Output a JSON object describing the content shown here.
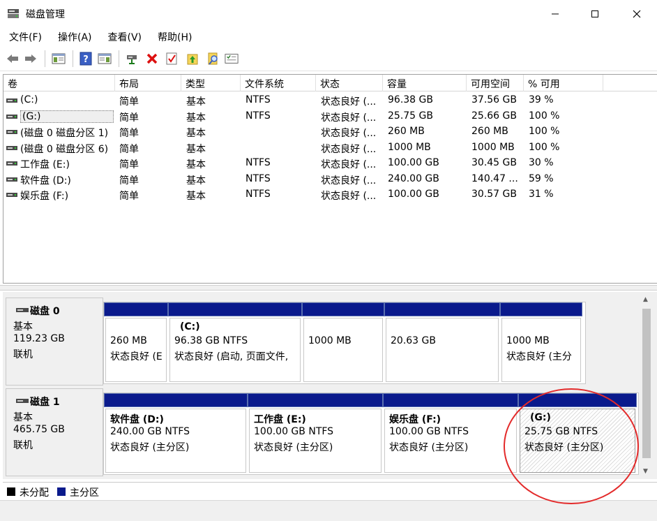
{
  "window": {
    "title": "磁盘管理",
    "controls": {
      "minimize": "minimize-icon",
      "maximize": "maximize-icon",
      "close": "close-icon"
    }
  },
  "menu": {
    "items": [
      {
        "label": "文件(F)"
      },
      {
        "label": "操作(A)"
      },
      {
        "label": "查看(V)"
      },
      {
        "label": "帮助(H)"
      }
    ]
  },
  "toolbar": {
    "buttons": [
      "back-icon",
      "forward-icon",
      "console-tree-icon",
      "help-icon",
      "properties-icon",
      "connect-drive-icon",
      "delete-icon",
      "check-icon",
      "up-folder-icon",
      "search-icon",
      "details-icon"
    ]
  },
  "volume_list": {
    "columns": [
      "卷",
      "布局",
      "类型",
      "文件系统",
      "状态",
      "容量",
      "可用空间",
      "% 可用"
    ],
    "rows": [
      {
        "volume": "(C:)",
        "layout": "简单",
        "type": "基本",
        "fs": "NTFS",
        "status": "状态良好 (...",
        "capacity": "96.38 GB",
        "free": "37.56 GB",
        "pct": "39 %"
      },
      {
        "volume": "(G:)",
        "layout": "简单",
        "type": "基本",
        "fs": "NTFS",
        "status": "状态良好 (...",
        "capacity": "25.75 GB",
        "free": "25.66 GB",
        "pct": "100 %"
      },
      {
        "volume": "(磁盘 0 磁盘分区 1)",
        "layout": "简单",
        "type": "基本",
        "fs": "",
        "status": "状态良好 (...",
        "capacity": "260 MB",
        "free": "260 MB",
        "pct": "100 %"
      },
      {
        "volume": "(磁盘 0 磁盘分区 6)",
        "layout": "简单",
        "type": "基本",
        "fs": "",
        "status": "状态良好 (...",
        "capacity": "1000 MB",
        "free": "1000 MB",
        "pct": "100 %"
      },
      {
        "volume": "工作盘 (E:)",
        "layout": "简单",
        "type": "基本",
        "fs": "NTFS",
        "status": "状态良好 (...",
        "capacity": "100.00 GB",
        "free": "30.45 GB",
        "pct": "30 %"
      },
      {
        "volume": "软件盘 (D:)",
        "layout": "简单",
        "type": "基本",
        "fs": "NTFS",
        "status": "状态良好 (...",
        "capacity": "240.00 GB",
        "free": "140.47 ...",
        "pct": "59 %"
      },
      {
        "volume": "娱乐盘 (F:)",
        "layout": "简单",
        "type": "基本",
        "fs": "NTFS",
        "status": "状态良好 (...",
        "capacity": "100.00 GB",
        "free": "30.57 GB",
        "pct": "31 %"
      }
    ]
  },
  "disks": [
    {
      "name": "磁盘 0",
      "type": "基本",
      "size": "119.23 GB",
      "state": "联机",
      "partitions": [
        {
          "name": "",
          "size": "260 MB",
          "status": "状态良好 (E"
        },
        {
          "name": "(C:)",
          "size": "96.38 GB NTFS",
          "status": "状态良好 (启动, 页面文件,"
        },
        {
          "name": "",
          "size": "1000 MB",
          "status": ""
        },
        {
          "name": "",
          "size": "20.63 GB",
          "status": ""
        },
        {
          "name": "",
          "size": "1000 MB",
          "status": "状态良好 (主分"
        }
      ]
    },
    {
      "name": "磁盘 1",
      "type": "基本",
      "size": "465.75 GB",
      "state": "联机",
      "partitions": [
        {
          "name": "软件盘 (D:)",
          "size": "240.00 GB NTFS",
          "status": "状态良好 (主分区)"
        },
        {
          "name": "工作盘 (E:)",
          "size": "100.00 GB NTFS",
          "status": "状态良好 (主分区)"
        },
        {
          "name": "娱乐盘 (F:)",
          "size": "100.00 GB NTFS",
          "status": "状态良好 (主分区)"
        },
        {
          "name": "(G:)",
          "size": "25.75 GB NTFS",
          "status": "状态良好 (主分区)"
        }
      ]
    }
  ],
  "legend": [
    {
      "label": "未分配",
      "color": "#000000"
    },
    {
      "label": "主分区",
      "color": "#0a1a8c"
    }
  ],
  "colors": {
    "primary_partition": "#0a1a8c",
    "unallocated": "#000000",
    "annotation": "#e32a2a"
  }
}
